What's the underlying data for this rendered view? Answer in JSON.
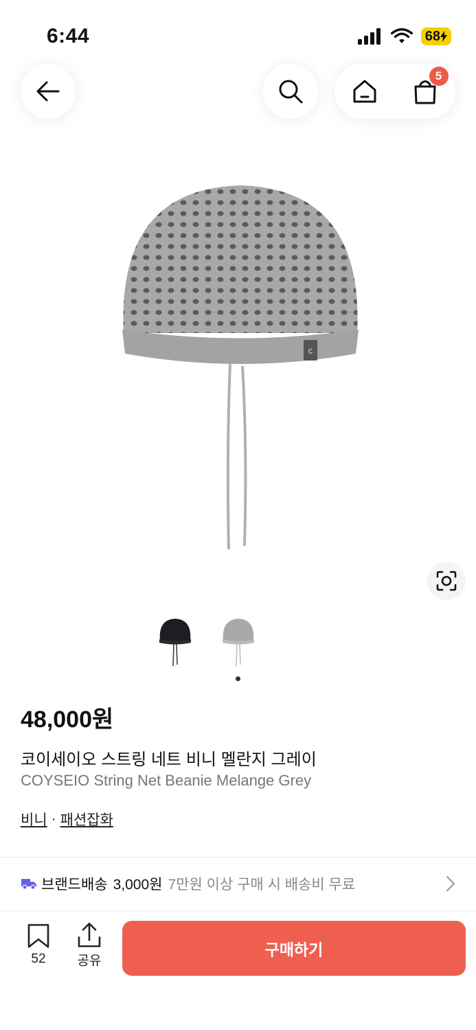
{
  "status_bar": {
    "time": "6:44",
    "battery": "68"
  },
  "header": {
    "cart_count": "5"
  },
  "product": {
    "price": "48,000원",
    "title_ko": "코이세이오 스트링 네트 비니 멜란지 그레이",
    "title_en": "COYSEIO String Net Beanie Melange Grey",
    "category_1": "비니",
    "separator": "·",
    "category_2": "패션잡화"
  },
  "color_options": [
    {
      "name": "black",
      "color": "#1c1e24"
    },
    {
      "name": "grey",
      "color": "#a9a9a9"
    }
  ],
  "shipping": {
    "label": "브랜드배송",
    "fee": "3,000원",
    "note": "7만원 이상 구매 시 배송비 무료"
  },
  "bottom_bar": {
    "save_count": "52",
    "share_label": "공유",
    "buy_label": "구매하기"
  },
  "colors": {
    "accent": "#ef5f4f",
    "badge": "#ef5a4b",
    "battery": "#f5d000",
    "truck": "#6b63e6"
  }
}
